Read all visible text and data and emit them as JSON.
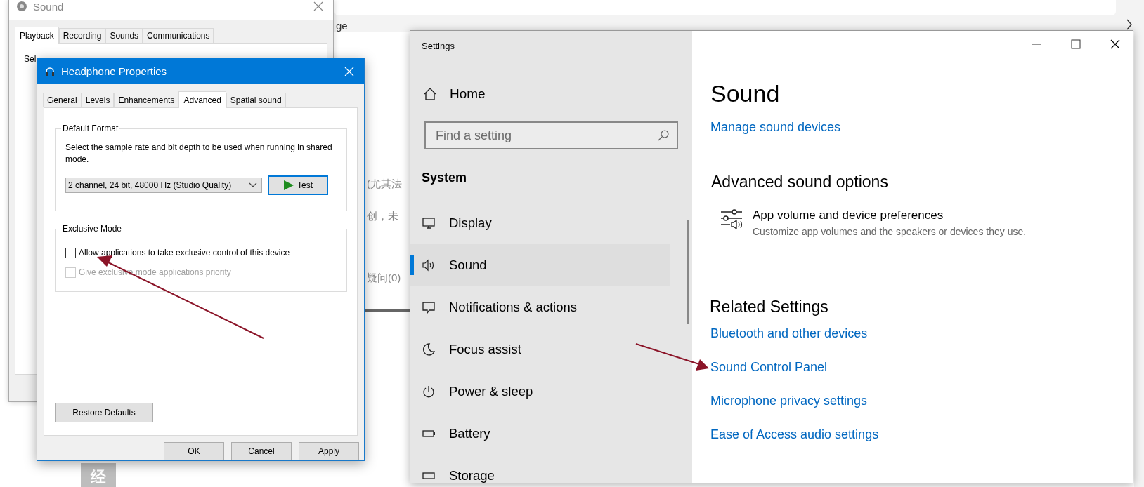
{
  "background_page": {
    "tab_fragment": "ge",
    "fragments": [
      "(尤其法",
      "创，未",
      "疑问(0)"
    ],
    "corner_fragment": "经"
  },
  "sound_window": {
    "title": "Sound",
    "tabs": [
      {
        "label": "Playback",
        "selected": true
      },
      {
        "label": "Recording",
        "selected": false
      },
      {
        "label": "Sounds",
        "selected": false
      },
      {
        "label": "Communications",
        "selected": false
      }
    ],
    "instruction_fragment": "Sel"
  },
  "properties_dialog": {
    "title": "Headphone Properties",
    "tabs": [
      {
        "label": "General",
        "selected": false
      },
      {
        "label": "Levels",
        "selected": false
      },
      {
        "label": "Enhancements",
        "selected": false
      },
      {
        "label": "Advanced",
        "selected": true
      },
      {
        "label": "Spatial sound",
        "selected": false
      }
    ],
    "default_format": {
      "label": "Default Format",
      "description": "Select the sample rate and bit depth to be used when running in shared mode.",
      "format": "2 channel, 24 bit, 48000 Hz (Studio Quality)",
      "test_button": "Test"
    },
    "exclusive_mode": {
      "label": "Exclusive Mode",
      "options": [
        {
          "label": "Allow applications to take exclusive control of this device",
          "checked": false,
          "disabled": false
        },
        {
          "label": "Give exclusive mode applications priority",
          "checked": false,
          "disabled": true
        }
      ]
    },
    "restore_button": "Restore Defaults",
    "buttons": [
      "OK",
      "Cancel",
      "Apply"
    ]
  },
  "settings_window": {
    "title": "Settings",
    "home": "Home",
    "search": {
      "placeholder": "Find a setting"
    },
    "section": "System",
    "nav": [
      {
        "label": "Display",
        "kind": "display",
        "selected": false
      },
      {
        "label": "Sound",
        "kind": "sound",
        "selected": true
      },
      {
        "label": "Notifications & actions",
        "kind": "notifications",
        "selected": false
      },
      {
        "label": "Focus assist",
        "kind": "focus",
        "selected": false
      },
      {
        "label": "Power & sleep",
        "kind": "power",
        "selected": false
      },
      {
        "label": "Battery",
        "kind": "battery",
        "selected": false
      },
      {
        "label": "Storage",
        "kind": "storage",
        "selected": false
      }
    ],
    "page_title": "Sound",
    "manage_link": "Manage sound devices",
    "advanced_heading": "Advanced sound options",
    "app_volume": {
      "title": "App volume and device preferences",
      "description": "Customize app volumes and the speakers or devices they use."
    },
    "related_heading": "Related Settings",
    "related_links": [
      "Bluetooth and other devices",
      "Sound Control Panel",
      "Microphone privacy settings",
      "Ease of Access audio settings"
    ]
  }
}
